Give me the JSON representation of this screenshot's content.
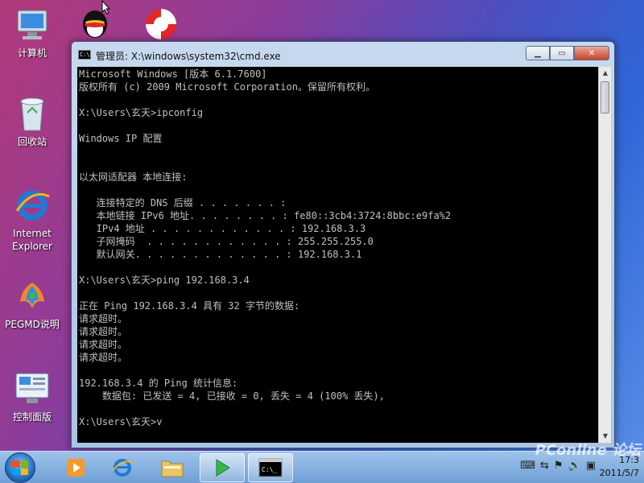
{
  "desktop": {
    "icons": [
      {
        "label": "计算机",
        "name": "computer-icon"
      },
      {
        "label": "回收站",
        "name": "recycle-bin-icon"
      },
      {
        "label": "Internet Explorer",
        "name": "internet-explorer-icon"
      },
      {
        "label": "PEGMD说明",
        "name": "pegmd-icon"
      },
      {
        "label": "控制面版",
        "name": "control-panel-icon"
      }
    ]
  },
  "window": {
    "title": "管理员: X:\\windows\\system32\\cmd.exe",
    "icon_text": "C:\\",
    "controls": {
      "minimize": "▁",
      "maximize": "▭",
      "close": "✕"
    },
    "console_text": "Microsoft Windows [版本 6.1.7600]\n版权所有 (c) 2009 Microsoft Corporation。保留所有权利。\n\nX:\\Users\\玄天>ipconfig\n\nWindows IP 配置\n\n\n以太网适配器 本地连接:\n\n   连接特定的 DNS 后缀 . . . . . . . :\n   本地链接 IPv6 地址. . . . . . . . : fe80::3cb4:3724:8bbc:e9fa%2\n   IPv4 地址 . . . . . . . . . . . . : 192.168.3.3\n   子网掩码  . . . . . . . . . . . . : 255.255.255.0\n   默认网关. . . . . . . . . . . . . : 192.168.3.1\n\nX:\\Users\\玄天>ping 192.168.3.4\n\n正在 Ping 192.168.3.4 具有 32 字节的数据:\n请求超时。\n请求超时。\n请求超时。\n请求超时。\n\n192.168.3.4 的 Ping 统计信息:\n    数据包: 已发送 = 4, 已接收 = 0, 丢失 = 4 (100% 丢失),\n\nX:\\Users\\玄天>v"
  },
  "taskbar": {
    "clock_time": "17:3",
    "clock_date": "2011/5/7",
    "watermark": "PConline 论坛"
  },
  "colors": {
    "console_bg": "#000000",
    "console_fg": "#c0c0c0",
    "taskbar": "#7fa9dc"
  }
}
